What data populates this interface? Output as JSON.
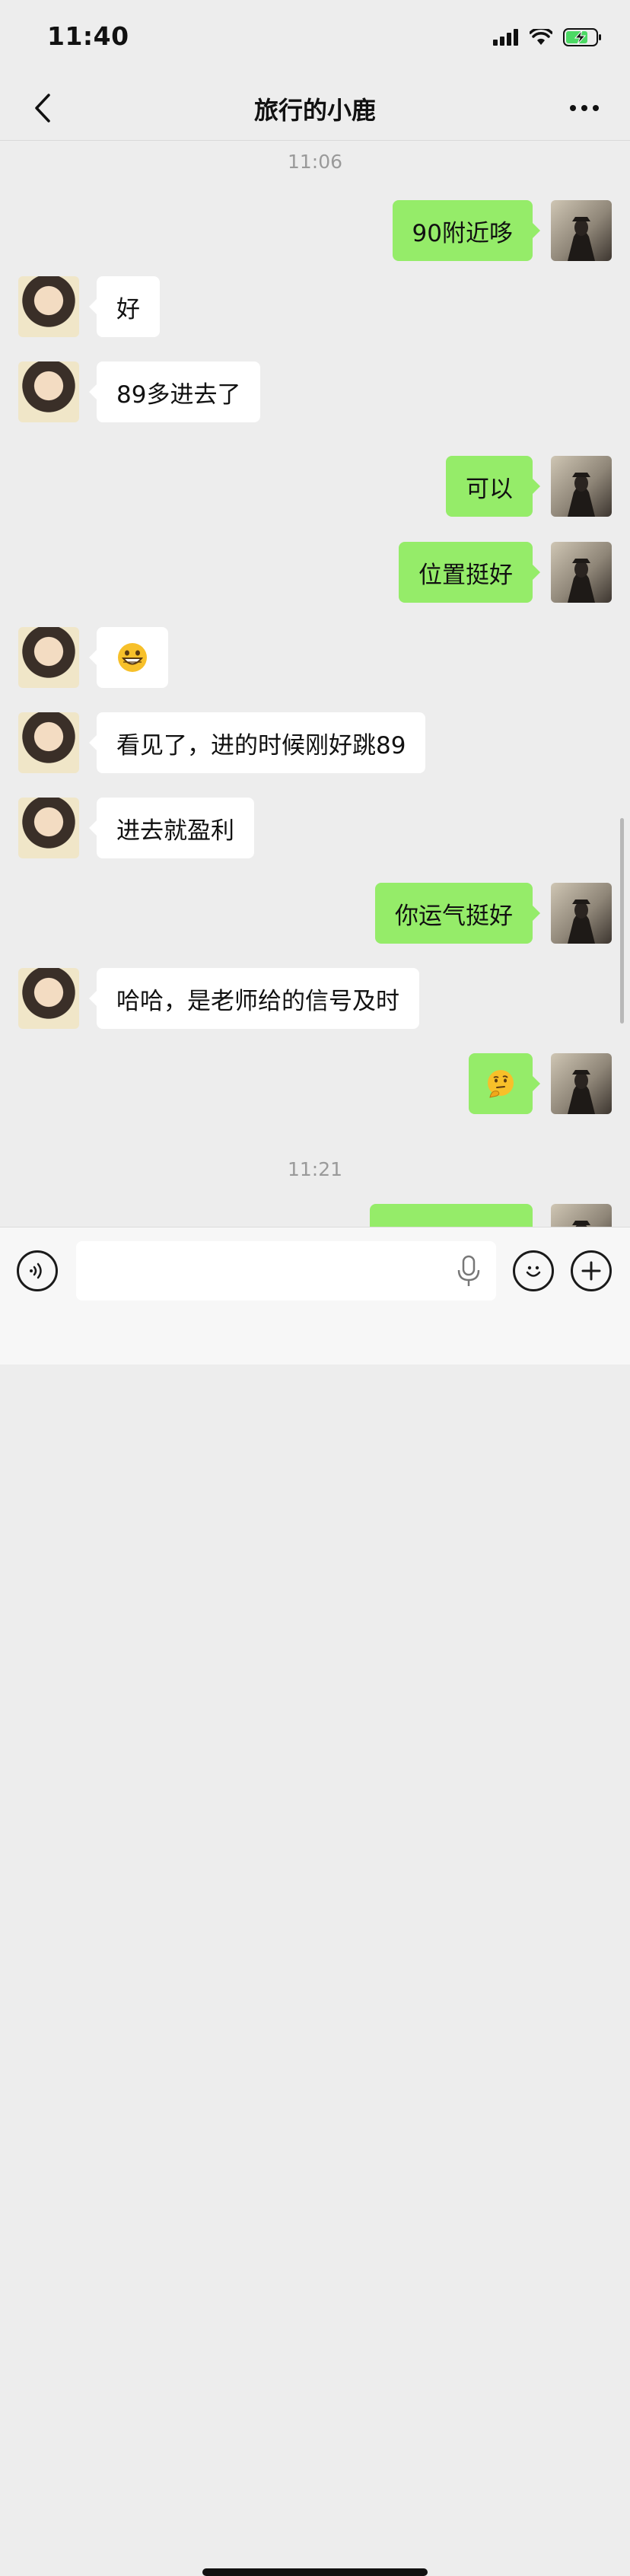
{
  "status_bar": {
    "time": "11:40"
  },
  "header": {
    "title": "旅行的小鹿"
  },
  "chat": {
    "timestamps": [
      "11:06",
      "11:21"
    ],
    "messages": [
      {
        "side": "right",
        "text": "90附近哆"
      },
      {
        "side": "left",
        "text": "好"
      },
      {
        "side": "left",
        "text": "89多进去了"
      },
      {
        "side": "right",
        "text": "可以"
      },
      {
        "side": "right",
        "text": "位置挺好"
      },
      {
        "side": "left",
        "emoji": "grinning-face"
      },
      {
        "side": "left",
        "text": "看见了，进的时候刚好跳89"
      },
      {
        "side": "left",
        "text": "进去就盈利"
      },
      {
        "side": "right",
        "text": "你运气挺好"
      },
      {
        "side": "left",
        "text": "哈哈，是老师给的信号及时"
      },
      {
        "side": "right",
        "emoji": "thinking-face"
      }
    ]
  },
  "input": {
    "value": "",
    "placeholder": ""
  },
  "colors": {
    "sent_bubble": "#95ec69",
    "received_bubble": "#ffffff",
    "background": "#ededed"
  }
}
